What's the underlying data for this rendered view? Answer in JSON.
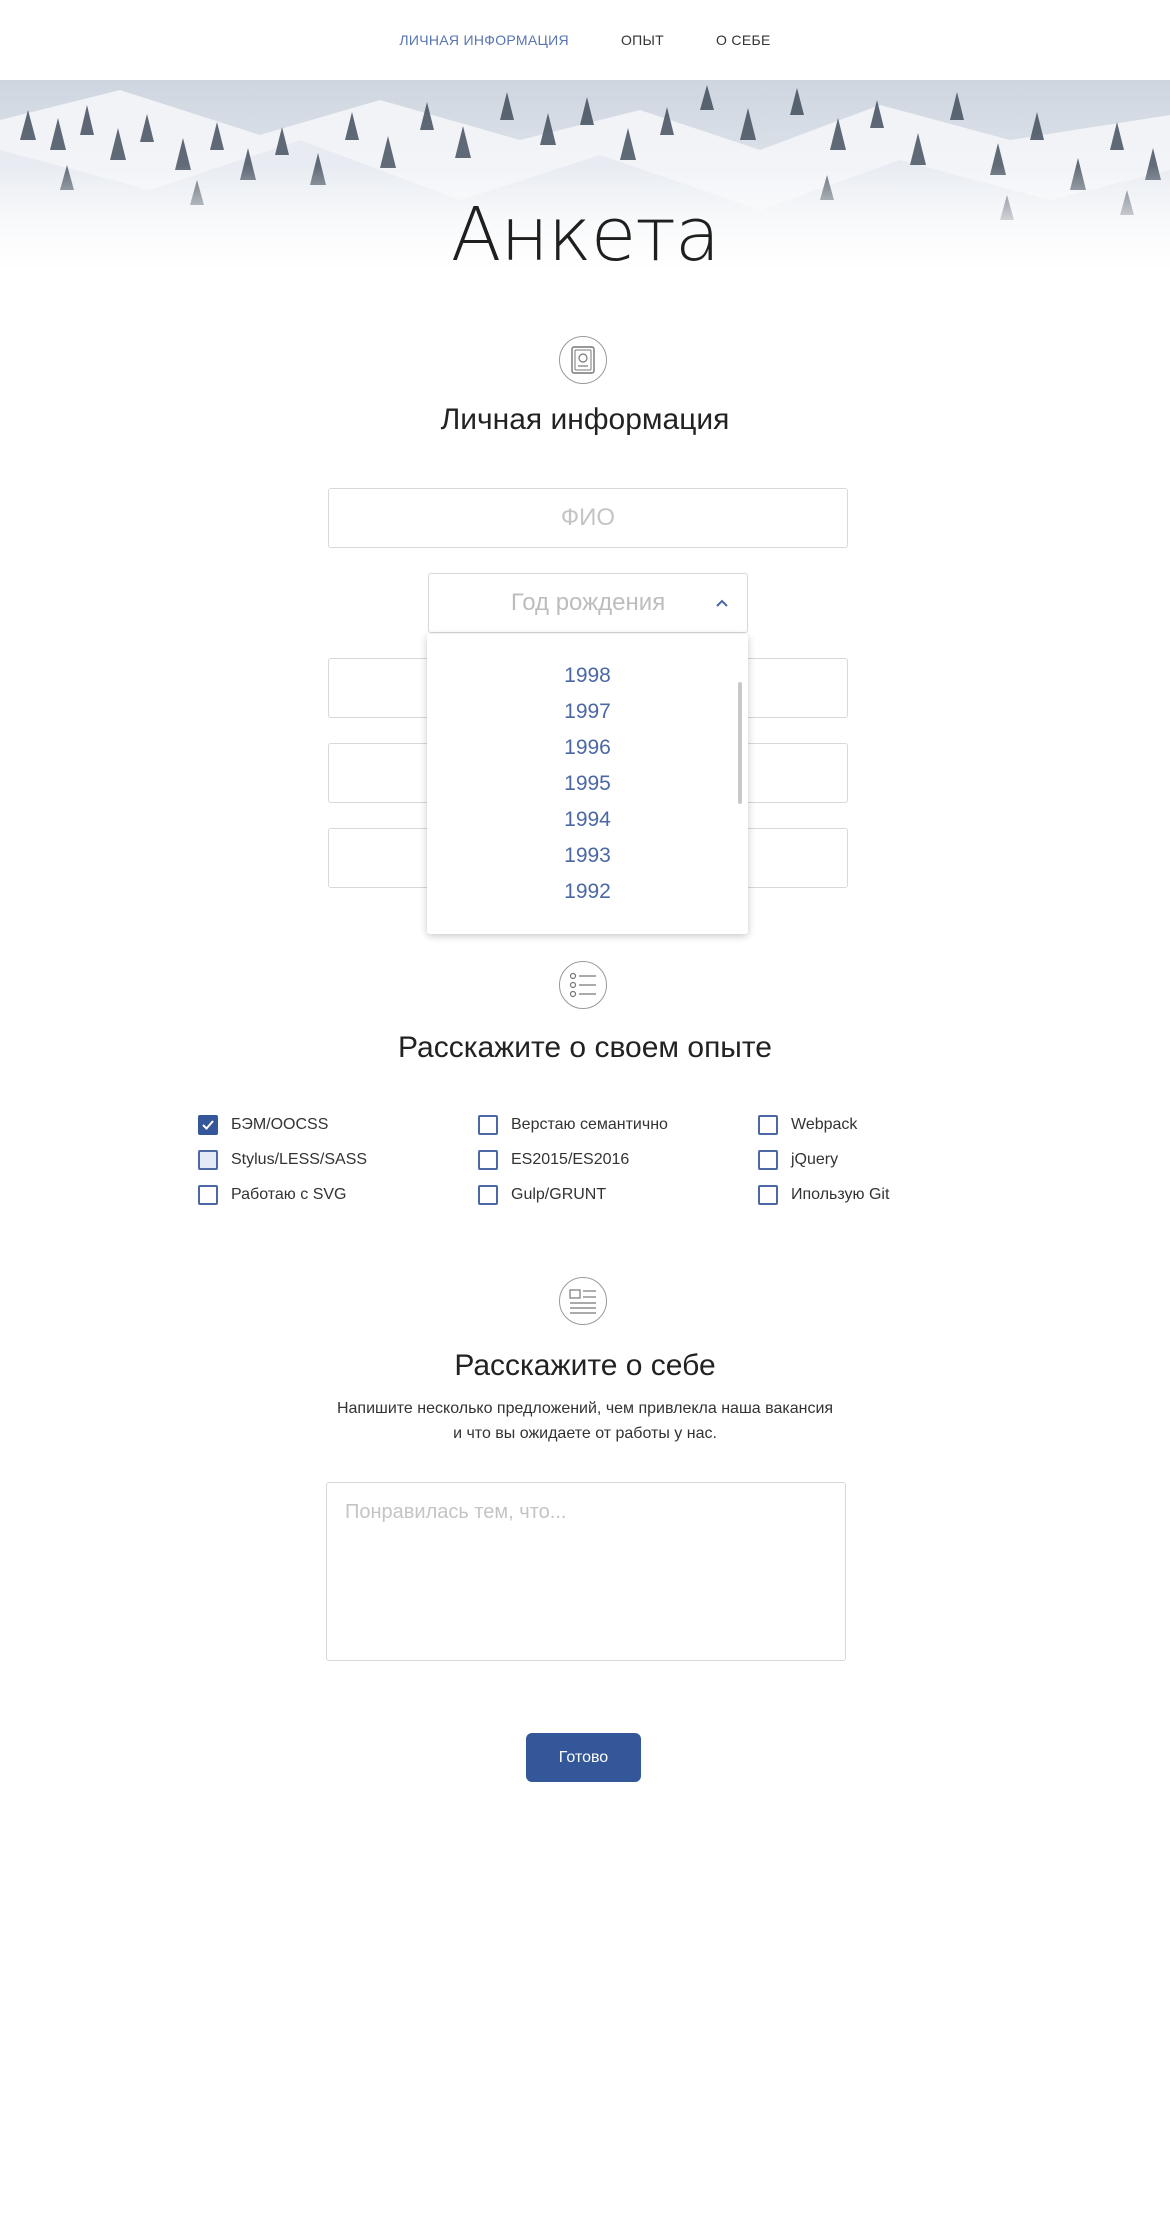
{
  "nav": {
    "items": [
      {
        "label": "ЛИЧНАЯ ИНФОРМАЦИЯ",
        "active": true
      },
      {
        "label": "ОПЫТ",
        "active": false
      },
      {
        "label": "О СЕБЕ",
        "active": false
      }
    ]
  },
  "page_title": "Анкета",
  "personal": {
    "title": "Личная информация",
    "icon": "passport-icon",
    "name_placeholder": "ФИО",
    "year_placeholder": "Год рождения",
    "year_options": [
      "1998",
      "1997",
      "1996",
      "1995",
      "1994",
      "1993",
      "1992"
    ]
  },
  "experience": {
    "title": "Расскажите о своем опыте",
    "icon": "list-icon",
    "checkboxes": [
      {
        "label": "БЭМ/OOCSS",
        "checked": true
      },
      {
        "label": "Верстаю семантично",
        "checked": false
      },
      {
        "label": "Webpack",
        "checked": false
      },
      {
        "label": "Stylus/LESS/SASS",
        "checked": false
      },
      {
        "label": "ES2015/ES2016",
        "checked": false
      },
      {
        "label": "jQuery",
        "checked": false
      },
      {
        "label": "Работаю с SVG",
        "checked": false
      },
      {
        "label": "Gulp/GRUNT",
        "checked": false
      },
      {
        "label": "Ипользую Git",
        "checked": false
      }
    ]
  },
  "about": {
    "title": "Расскажите о себе",
    "icon": "article-icon",
    "line1": "Напишите несколько предложений, чем привлекла наша вакансия",
    "line2": "и что вы ожидаете от работы у нас.",
    "placeholder": "Понравилась тем, что..."
  },
  "submit_label": "Готово",
  "colors": {
    "accent": "#34579a",
    "link": "#5875b3"
  }
}
